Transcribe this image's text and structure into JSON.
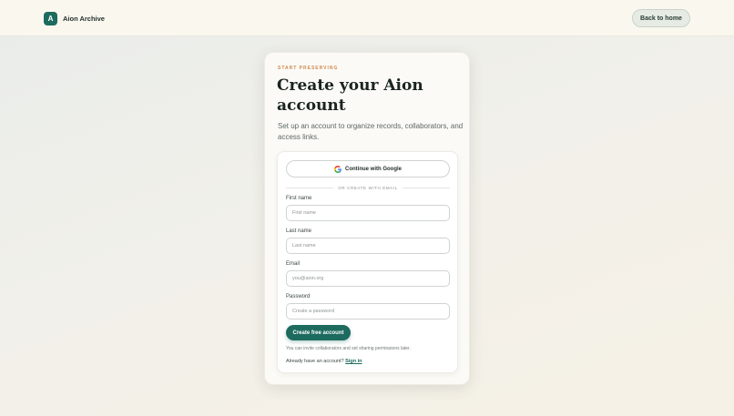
{
  "header": {
    "logo_letter": "A",
    "brand_name": "Aion Archive",
    "back_label": "Back to home"
  },
  "card": {
    "eyebrow": "START PRESERVING",
    "title": "Create your Aion account",
    "subtitle": "Set up an account to organize records, collaborators, and access links."
  },
  "form": {
    "google_label": "Continue with Google",
    "divider_text": "OR CREATE WITH EMAIL",
    "first_name": {
      "label": "First name",
      "placeholder": "First name",
      "value": ""
    },
    "last_name": {
      "label": "Last name",
      "placeholder": "Last name",
      "value": ""
    },
    "email": {
      "label": "Email",
      "placeholder": "you@aion.org",
      "value": ""
    },
    "password": {
      "label": "Password",
      "placeholder": "Create a password",
      "value": ""
    },
    "submit_label": "Create free account",
    "hint": "You can invite collaborators and set sharing permissions later.",
    "signin_prompt": "Already have an account?",
    "signin_link": "Sign in"
  },
  "colors": {
    "accent": "#1d6b5f",
    "eyebrow": "#d08a4c"
  }
}
